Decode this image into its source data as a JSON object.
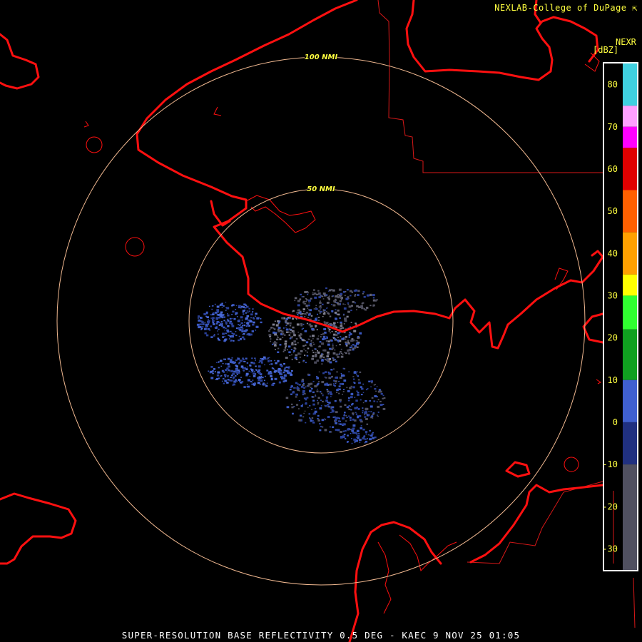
{
  "header": {
    "credit": "NEXLAB-College of DuPage",
    "credit_icon": "external-link-icon",
    "product": "NEXR",
    "unit": "[dBZ]"
  },
  "range_rings": [
    {
      "label": "100 NMI",
      "distance_nmi": 100
    },
    {
      "label": "50 NMI",
      "distance_nmi": 50
    }
  ],
  "colorbar": {
    "ticks": [
      "80",
      "70",
      "60",
      "50",
      "40",
      "30",
      "20",
      "10",
      "0",
      "-10",
      "-20",
      "-30"
    ],
    "tick_values": [
      80,
      70,
      60,
      50,
      40,
      30,
      20,
      10,
      0,
      -10,
      -20,
      -30
    ],
    "range": [
      -35,
      85
    ],
    "tick_color": "#ffff40",
    "stops": [
      {
        "from": 75,
        "to": 85,
        "color": "#40d0e0"
      },
      {
        "from": 70,
        "to": 75,
        "color": "#ffa0ff"
      },
      {
        "from": 65,
        "to": 70,
        "color": "#ff00ff"
      },
      {
        "from": 55,
        "to": 65,
        "color": "#e00000"
      },
      {
        "from": 45,
        "to": 55,
        "color": "#ff6000"
      },
      {
        "from": 35,
        "to": 45,
        "color": "#ffa000"
      },
      {
        "from": 30,
        "to": 35,
        "color": "#ffff00"
      },
      {
        "from": 22,
        "to": 30,
        "color": "#30ff30"
      },
      {
        "from": 10,
        "to": 22,
        "color": "#10a020"
      },
      {
        "from": 0,
        "to": 10,
        "color": "#4060d0"
      },
      {
        "from": -10,
        "to": 0,
        "color": "#203080"
      },
      {
        "from": -35,
        "to": -10,
        "color": "#505060"
      }
    ]
  },
  "colors": {
    "coastline": "#ff1010",
    "boundary": "#d81818",
    "range_ring": "#f0b890",
    "ring_label": "#ffff40"
  },
  "caption": "SUPER-RESOLUTION BASE REFLECTIVITY 0.5 DEG - KAEC 9 NOV 25 01:05"
}
